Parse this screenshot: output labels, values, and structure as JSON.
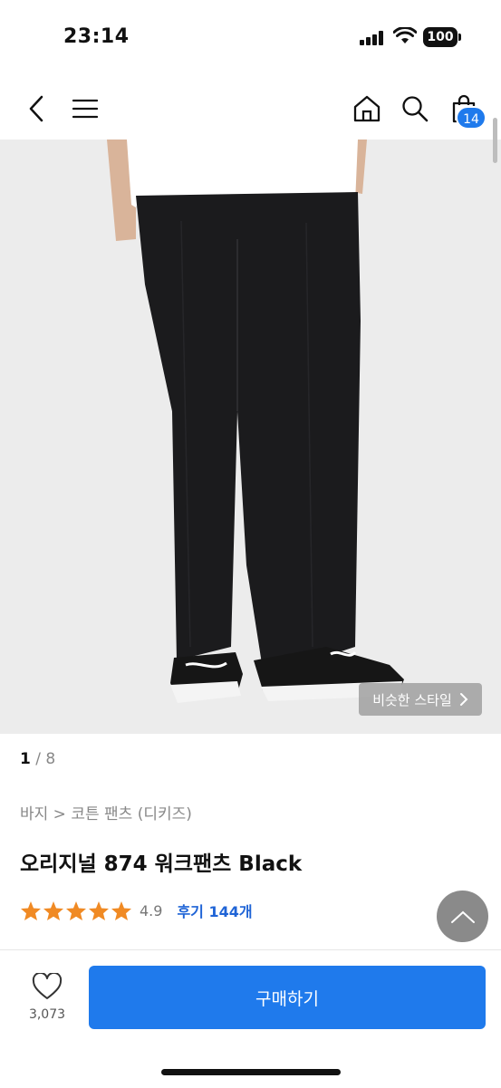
{
  "status_bar": {
    "time": "23:14",
    "battery": "100"
  },
  "header": {
    "cart_count": "14"
  },
  "gallery": {
    "similar_style_label": "비슷한 스타일",
    "current_page": "1",
    "total_pages": "8"
  },
  "product": {
    "breadcrumb": "바지 > 코튼 팬츠 (디키즈)",
    "title": "오리지널 874 워크팬츠 Black",
    "rating": "4.9",
    "stars": 5,
    "reviews_label": "후기 144개"
  },
  "bottom_bar": {
    "like_count": "3,073",
    "buy_label": "구매하기"
  },
  "colors": {
    "accent": "#1f7aec",
    "star": "#f08a24",
    "review_link": "#1f64d6"
  }
}
